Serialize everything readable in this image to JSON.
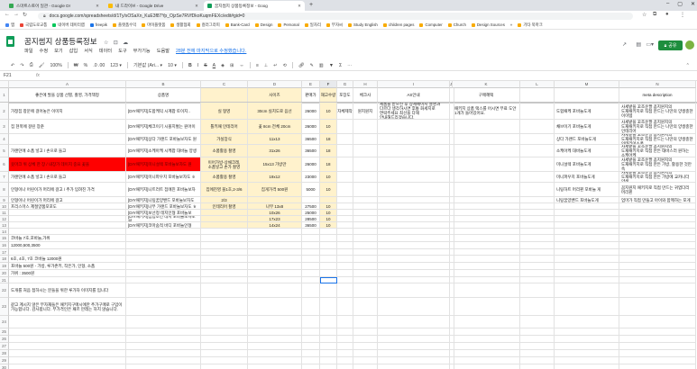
{
  "browser": {
    "tabs": [
      {
        "title": "스마트스토어 일관 - Google Dr",
        "color": "#34a853"
      },
      {
        "title": "내 드라이브 - Google Drive",
        "color": "#fbbc04"
      },
      {
        "title": "꿈지썸지 상품등록정보 - Goog",
        "color": "#0f9d58"
      }
    ],
    "new_tab": "+",
    "url": "docs.google.com/spreadsheets/d/1Ty/sOSaXn_KuE3f87Yp_OjzSe7RVfDkoKuqmFEXc/edit#gid=0",
    "bookmarks": [
      "앱",
      "국립도로교통",
      "네이버 데이터랩",
      "freepik",
      "플랫폼수익",
      "마이플랫폼",
      "생활협회",
      "컬러그라피",
      "Bank-Card",
      "Design",
      "Personal",
      "일자리",
      "부자씨",
      "Study English",
      "children pages",
      "Computer",
      "Church",
      "Design Sources",
      "»",
      "기타 북마크"
    ]
  },
  "docs": {
    "title": "꿈지썸지 상품등록정보",
    "menus": [
      "파일",
      "수정",
      "보기",
      "삽입",
      "서식",
      "데이터",
      "도구",
      "부가기능",
      "도움말"
    ],
    "last_edit": "28분 전에 마지막으로 수정했습니다.",
    "share_label": "공유"
  },
  "toolbar": {
    "zoom": "100%",
    "currency": "₩",
    "percent": "%",
    "decimals": ".0 .00",
    "format": "123 ▾",
    "font": "기본값 (Ari... ▾",
    "size": "10 ▾",
    "bold": "B",
    "italic": "I",
    "strike": "S",
    "underline": "A",
    "more": "⋯"
  },
  "formula_bar": {
    "cell_ref": "F21",
    "fx": "fx",
    "content": ""
  },
  "grid": {
    "columns": [
      "A",
      "B",
      "C",
      "D",
      "E",
      "F",
      "G",
      "H",
      "I",
      "J",
      "K",
      "L",
      "M",
      "N"
    ],
    "selected_column": "F",
    "rows": [
      {
        "n": "1",
        "h": 16,
        "cells": {
          "A": "좋은에 발을 상품 선별, 촬영, 가격책정",
          "B": "상품명",
          "C": "",
          "D": "사이즈",
          "E": "판매가",
          "F": "재고수량",
          "G": "포장도",
          "H": "체크사",
          "I": "AS안내",
          "J": "",
          "K": "구매혜택",
          "L": "",
          "M": "",
          "N": "meta description"
        }
      },
      {
        "n": "2",
        "h": 19,
        "cells": {
          "A": "가정집 창문에 걸어놓은 이미지",
          "B": "[DIY패키지]도합케익 시계팝 토이지..",
          "C": "실 형영",
          "D": "30cm 실치도로 음선",
          "E": "26000",
          "F": "10",
          "G": "자체제작",
          "H": "원지원지",
          "I": "제품을 받으신 후 상세페이지 설명과 다르다 생각하시면 후통 화세지로 연락주세요 최선을 다해 안내해드리겠습니다.",
          "K": "패키지 상품 택스를 어시면 무료 도안 1개가 들어있어요.",
          "M": "도합패케 포바늘도게",
          "N": "사세밭을 꼬조운팔 꼼지원지의 도재패키지로 직접 만드는 나만의 양생충한 이이템"
        }
      },
      {
        "n": "3",
        "h": 16,
        "cells": {
          "A": "집 현폭에 걸린 장준",
          "B": "[DIY패키지]체크이기 시볼지벌는 원어이",
          "C": "톨키패 인테리어",
          "D": "꽃 8cm 전체 20cm",
          "E": "26000",
          "F": "10",
          "M": "채브이기 포바늘도게",
          "N": "사세밭을 꼬조운팔 꼼지원지의 도재패키지로 직접 만드는 나만의 양생충한 인테리어"
        }
      },
      {
        "n": "4",
        "h": 12,
        "cells": {
          "A": "",
          "B": "[DIY패키지]상다 가랜드 포바늘보자도 원",
          "C": "가실장식",
          "D": "11x13",
          "E": "36500",
          "F": "18",
          "M": "상다 가랜드 포바늘도게",
          "N": "사세밭을 꼬조운팔 꼼지원지의 도재패키지로 직접 만드는 나만의 양생충한 인테리어소품"
        }
      },
      {
        "n": "5",
        "h": 14,
        "cells": {
          "A": "가랜던에 소품 넣고 / 손으로 들고",
          "B": "[DIY패키지]소케아케 시케팝 대바늘 양생",
          "C": "소품활용 촬영",
          "D": "31x26",
          "E": "36500",
          "F": "18",
          "M": "소케아케 대바늘도게",
          "N": "사세밭을 꼬조운팔 꼼지원지의 도재패키지로 직접 만든 태바스러 원하는 소케어케"
        }
      },
      {
        "n": "6",
        "h": 16,
        "cells": {
          "A": "옷마크 위 상체 한 장 / 내장가 데이지 중요 꽃을",
          "B": "[DIY패키지]미니설렉 포바늘보자도 원",
          "C": "이어가방-상채크레, 소품넣고 손가 촬영",
          "D": "15x13 가방만",
          "E": "26000",
          "F": "18",
          "M": "미니설렉 포바늘도게",
          "N": "사세밭을 꼬조운팔 꼼지원지의 도재패키지로 직접 만든 가방, 활용한 것만 속"
        }
      },
      {
        "n": "7",
        "h": 12,
        "cells": {
          "A": "가랜던에 소품 넣고 / 손으로 들고",
          "B": "[DIY패키지]미니파우치 포바늘보자도 ㅎ",
          "C": "소품활용 촬영",
          "D": "19x12",
          "E": "23000",
          "F": "10",
          "M": "미니파우치 포바늘도게",
          "N": "사세밭을 꼬조운팔 꼼지원지의 도재패키지로 직접 만든 가방에 교카니더 양생"
        }
      },
      {
        "n": "8",
        "h": 16,
        "cells": {
          "A": "인형이나 어린이가 머리에 걸고 / 추가 입혀진 가격",
          "B": "[DIY패키지]니트러트 집에진 포바늘보자",
          "C": "집에진영 블1호,2-3/6",
          "D": "집게가격 500원",
          "E": "5000",
          "F": "10",
          "M": "니팅하트 머리핀 포바늘 게",
          "N": "꼼지원지 패키지로 직접 만드는 귀엽다리 머리핀"
        }
      },
      {
        "n": "9",
        "h": 7,
        "cells": {
          "A": "인형이나 어린이가 머리에 걸고",
          "B": "[DIY패키지]니팅꿈양밴드 포바늘보자도",
          "C": "2/3",
          "D": "",
          "E": "",
          "F": "",
          "M": "니팅꿈양밴드 포바늘도게",
          "N": "엄마가 직접 만들고 아이와 함께하는 포게"
        }
      },
      {
        "n": "10",
        "h": 7,
        "cells": {
          "A": "프리스마스 제절양품포포도",
          "B": "[DIY패키지]나무 가랜드 포바늘보자도 ㅎ",
          "C": "인테리어 촬영",
          "D": "나무 13x8",
          "E": "27500",
          "F": "10"
        }
      },
      {
        "n": "11",
        "h": 7,
        "cells": {
          "A": "",
          "B": "[DIY패키지]보선정 테지인형 포바늘보",
          "C": "",
          "D": "10x26",
          "E": "25000",
          "F": "10"
        }
      },
      {
        "n": "12",
        "h": 7,
        "cells": {
          "A": "",
          "B": "[DIY패키지]집업소인 테지 포바늘보자도 원",
          "C": "",
          "D": "17x23",
          "E": "28500",
          "F": "10"
        }
      },
      {
        "n": "13",
        "h": 7,
        "cells": {
          "A": "",
          "B": "[DIY패키지]코마숨적 바디 포바늘인형",
          "C": "",
          "D": "14x24",
          "E": "36500",
          "F": "10"
        }
      },
      {
        "n": "14",
        "h": 7,
        "cells": {}
      },
      {
        "n": "15",
        "h": 8,
        "cells": {
          "A": "코바늘 7호,포바늘,가위"
        }
      },
      {
        "n": "16",
        "h": 8,
        "cells": {
          "A": "12000,500,3500"
        }
      },
      {
        "n": "17",
        "h": 7,
        "cells": {}
      },
      {
        "n": "18",
        "h": 8,
        "cells": {
          "A": "6호, 4호, 7호 코바늘 12000원"
        }
      },
      {
        "n": "19",
        "h": 8,
        "cells": {
          "A": "포바늘 500원 - 가방, 루가존키, 작은가, 인형, 소품"
        }
      },
      {
        "n": "20",
        "h": 8,
        "cells": {
          "A": "가위 : 3500원"
        }
      },
      {
        "n": "21",
        "h": 7,
        "cells": {}
      },
      {
        "n": "22",
        "h": 16,
        "cells": {
          "A": "도개를 처음 접하시는 분들을 위한 루가차 이미지를 입니다"
        }
      },
      {
        "n": "23",
        "h": 20,
        "cells": {
          "A": "같고 계시지 않은 부자재들은 패키지구매시에만 추가구매로 구입이 가능합니다. 감사합니다. 부가격인은 패르 만레는 하지 않습니다."
        }
      },
      {
        "n": "24",
        "h": 14,
        "cells": {}
      },
      {
        "n": "25",
        "h": 8,
        "cells": {}
      },
      {
        "n": "26",
        "h": 8,
        "cells": {}
      },
      {
        "n": "27",
        "h": 8,
        "cells": {}
      },
      {
        "n": "28",
        "h": 8,
        "cells": {}
      },
      {
        "n": "29",
        "h": 8,
        "cells": {}
      },
      {
        "n": "30",
        "h": 8,
        "cells": {}
      }
    ]
  },
  "colors": {
    "accent": "#1a73e8",
    "sheets_green": "#0f9d58",
    "highlight_yellow": "#fff2cc",
    "highlight_red": "#ff0000"
  }
}
